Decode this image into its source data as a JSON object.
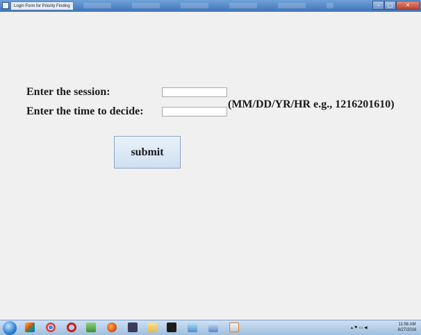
{
  "window": {
    "title": "Login Form for Priority Finding",
    "minimize_symbol": "–",
    "maximize_symbol": "□",
    "close_symbol": "✕"
  },
  "form": {
    "session_label": "Enter the session:",
    "session_value": "",
    "time_label": "Enter the time to decide:",
    "time_value": "",
    "time_hint": "(MM/DD/YR/HR e.g., 1216201610)",
    "submit_label": "submit"
  },
  "taskbar": {
    "icons": [
      "start-orb-icon",
      "windows-explorer-icon",
      "chrome-icon",
      "opera-icon",
      "notepad-icon",
      "firefox-icon",
      "visual-studio-icon",
      "folder-icon",
      "terminal-icon",
      "paint-icon",
      "word-icon",
      "java-icon"
    ],
    "tray_text": "▴ ⚑ ▭ ◀",
    "clock_time": "11:56 AM",
    "clock_date": "8/27/2016"
  }
}
